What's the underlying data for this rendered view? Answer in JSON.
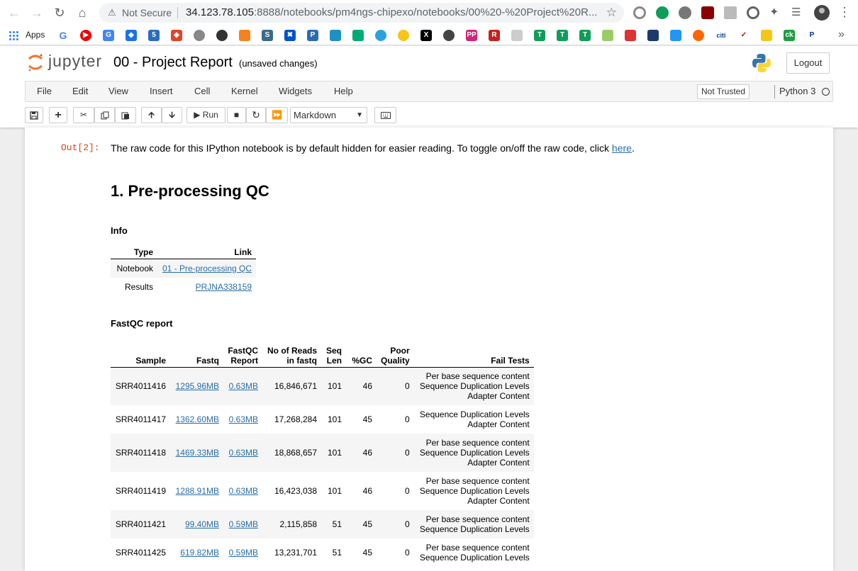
{
  "browser": {
    "security_label": "Not Secure",
    "url_host": "34.123.78.105",
    "url_rest": ":8888/notebooks/pm4ngs-chipexo/notebooks/00%20-%20Project%20R...",
    "bookmarks_apps": "Apps"
  },
  "jupyter": {
    "logo_text": "jupyter",
    "notebook_title": "00 - Project Report",
    "unsaved": "(unsaved changes)",
    "logout": "Logout",
    "menu": [
      "File",
      "Edit",
      "View",
      "Insert",
      "Cell",
      "Kernel",
      "Widgets",
      "Help"
    ],
    "trust_status": "Not Trusted",
    "kernel_name": "Python 3",
    "toolbar": {
      "run_label": "Run",
      "cell_type": "Markdown"
    }
  },
  "output": {
    "prompt": "Out[2]:",
    "message": "The raw code for this IPython notebook is by default hidden for easier reading. To toggle on/off the raw code, click ",
    "link_text": "here",
    "message_end": "."
  },
  "section": {
    "title": "1. Pre-processing QC",
    "info_heading": "Info",
    "info_table": {
      "headers": [
        "Type",
        "Link"
      ],
      "rows": [
        [
          "Notebook",
          "01 - Pre-processing QC"
        ],
        [
          "Results",
          "PRJNA338159"
        ]
      ]
    },
    "fastqc_heading": "FastQC report",
    "fastqc_table": {
      "headers": [
        "Sample",
        "Fastq",
        "FastQC Report",
        "No of Reads in fastq",
        "Seq Len",
        "%GC",
        "Poor Quality",
        "Fail Tests"
      ],
      "rows": [
        {
          "sample": "SRR4011416",
          "fastq": "1295.96MB",
          "report": "0.63MB",
          "reads": "16,846,671",
          "len": "101",
          "gc": "46",
          "poor": "0",
          "fail": [
            "Per base sequence content",
            "Sequence Duplication Levels",
            "Adapter Content"
          ]
        },
        {
          "sample": "SRR4011417",
          "fastq": "1362.60MB",
          "report": "0.63MB",
          "reads": "17,268,284",
          "len": "101",
          "gc": "45",
          "poor": "0",
          "fail": [
            "Sequence Duplication Levels",
            "Adapter Content"
          ]
        },
        {
          "sample": "SRR4011418",
          "fastq": "1469.33MB",
          "report": "0.63MB",
          "reads": "18,868,657",
          "len": "101",
          "gc": "46",
          "poor": "0",
          "fail": [
            "Per base sequence content",
            "Sequence Duplication Levels",
            "Adapter Content"
          ]
        },
        {
          "sample": "SRR4011419",
          "fastq": "1288.91MB",
          "report": "0.63MB",
          "reads": "16,423,038",
          "len": "101",
          "gc": "46",
          "poor": "0",
          "fail": [
            "Per base sequence content",
            "Sequence Duplication Levels",
            "Adapter Content"
          ]
        },
        {
          "sample": "SRR4011421",
          "fastq": "99.40MB",
          "report": "0.59MB",
          "reads": "2,115,858",
          "len": "51",
          "gc": "45",
          "poor": "0",
          "fail": [
            "Per base sequence content",
            "Sequence Duplication Levels"
          ]
        },
        {
          "sample": "SRR4011425",
          "fastq": "619.82MB",
          "report": "0.59MB",
          "reads": "13,231,701",
          "len": "51",
          "gc": "45",
          "poor": "0",
          "fail": [
            "Per base sequence content",
            "Sequence Duplication Levels"
          ]
        }
      ]
    }
  }
}
